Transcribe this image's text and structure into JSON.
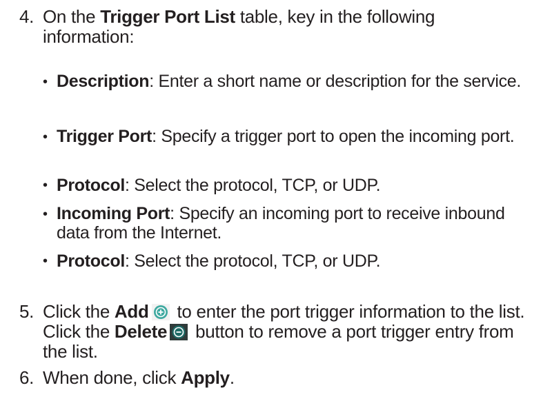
{
  "step4": {
    "number": "4.",
    "text_before": "On the ",
    "bold": "Trigger Port List",
    "text_after": " table, key in the following information:"
  },
  "bullets": [
    {
      "term": "Description",
      "desc": ": Enter a short name or description for the service."
    },
    {
      "term": "Trigger Port",
      "desc": ": Specify a trigger port to open the incoming port."
    },
    {
      "term": "Protocol",
      "desc": ": Select the protocol, TCP, or UDP."
    },
    {
      "term": "Incoming Port",
      "desc": ": Specify an incoming port to receive inbound data from the Internet."
    },
    {
      "term": "Protocol",
      "desc": ": Select the protocol, TCP, or UDP."
    }
  ],
  "step5": {
    "number": "5.",
    "t1": "Click the ",
    "add_label": "Add",
    "t2": " to enter the port trigger information to the list. Click the ",
    "delete_label": "Delete",
    "t3": " button to remove a port trigger entry from the list."
  },
  "step6": {
    "number": "6.",
    "t1": "When done, click ",
    "apply_label": "Apply",
    "t2": "."
  },
  "icons": {
    "add": "add-circle-icon",
    "delete": "delete-circle-icon"
  },
  "colors": {
    "text": "#231f20",
    "add_icon": "#4fb8b0",
    "delete_icon": "#2a6f6a"
  }
}
